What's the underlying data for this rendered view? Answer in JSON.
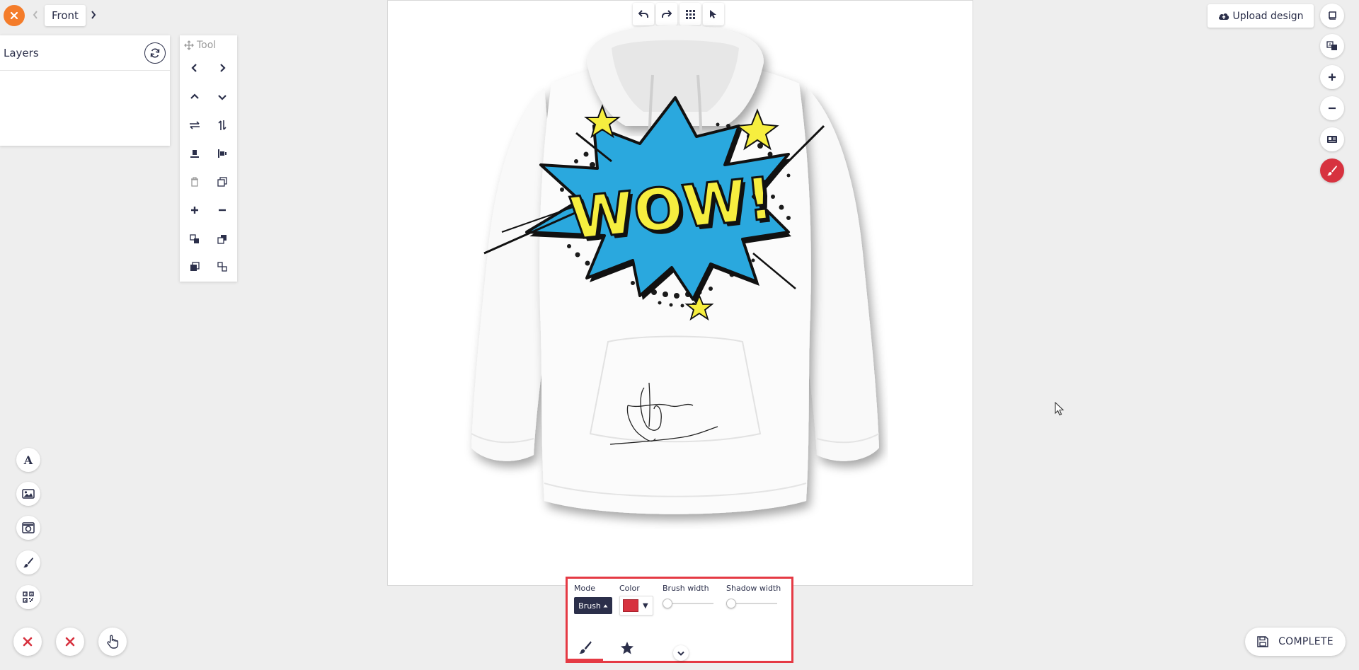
{
  "nav": {
    "side_label": "Front",
    "close_icon": "close-icon",
    "prev_icon": "chevron-left-icon",
    "next_icon": "chevron-right-icon"
  },
  "layers": {
    "title": "Layers",
    "refresh_icon": "refresh-icon"
  },
  "tool_panel": {
    "title": "Tool",
    "buttons": [
      "move-left",
      "move-right",
      "move-up",
      "move-down",
      "flip-horizontal",
      "flip-vertical",
      "align-bottom",
      "align-center",
      "delete",
      "duplicate",
      "zoom-in",
      "zoom-out",
      "bring-forward",
      "send-backward",
      "bring-to-front",
      "send-to-back"
    ]
  },
  "canvas_toolbar": [
    "undo",
    "redo",
    "grid",
    "select-pointer"
  ],
  "upload_button": {
    "label": "Upload design",
    "icon": "cloud-upload-icon"
  },
  "right_tools": [
    "book-icon",
    "translate-icon",
    "zoom-in-icon",
    "zoom-out-icon",
    "id-card-icon",
    "brush-icon"
  ],
  "left_tools": [
    "text-icon",
    "image-icon",
    "camera-icon",
    "brush-icon",
    "qr-code-icon"
  ],
  "bottom_actions": [
    "clear-icon",
    "delete-icon",
    "hand-pointer-icon"
  ],
  "brush_panel": {
    "mode_label": "Mode",
    "mode_value": "Brush",
    "color_label": "Color",
    "color_value": "#d7323f",
    "brush_width_label": "Brush width",
    "shadow_width_label": "Shadow width",
    "tabs": [
      "brush-tab",
      "star-tab"
    ]
  },
  "complete_button": {
    "label": "COMPLETE"
  },
  "colors": {
    "accent": "#d7323f",
    "brand_orange": "#f47c2a",
    "navy": "#2b2f4a"
  },
  "artwork": {
    "text": "WOW!"
  }
}
